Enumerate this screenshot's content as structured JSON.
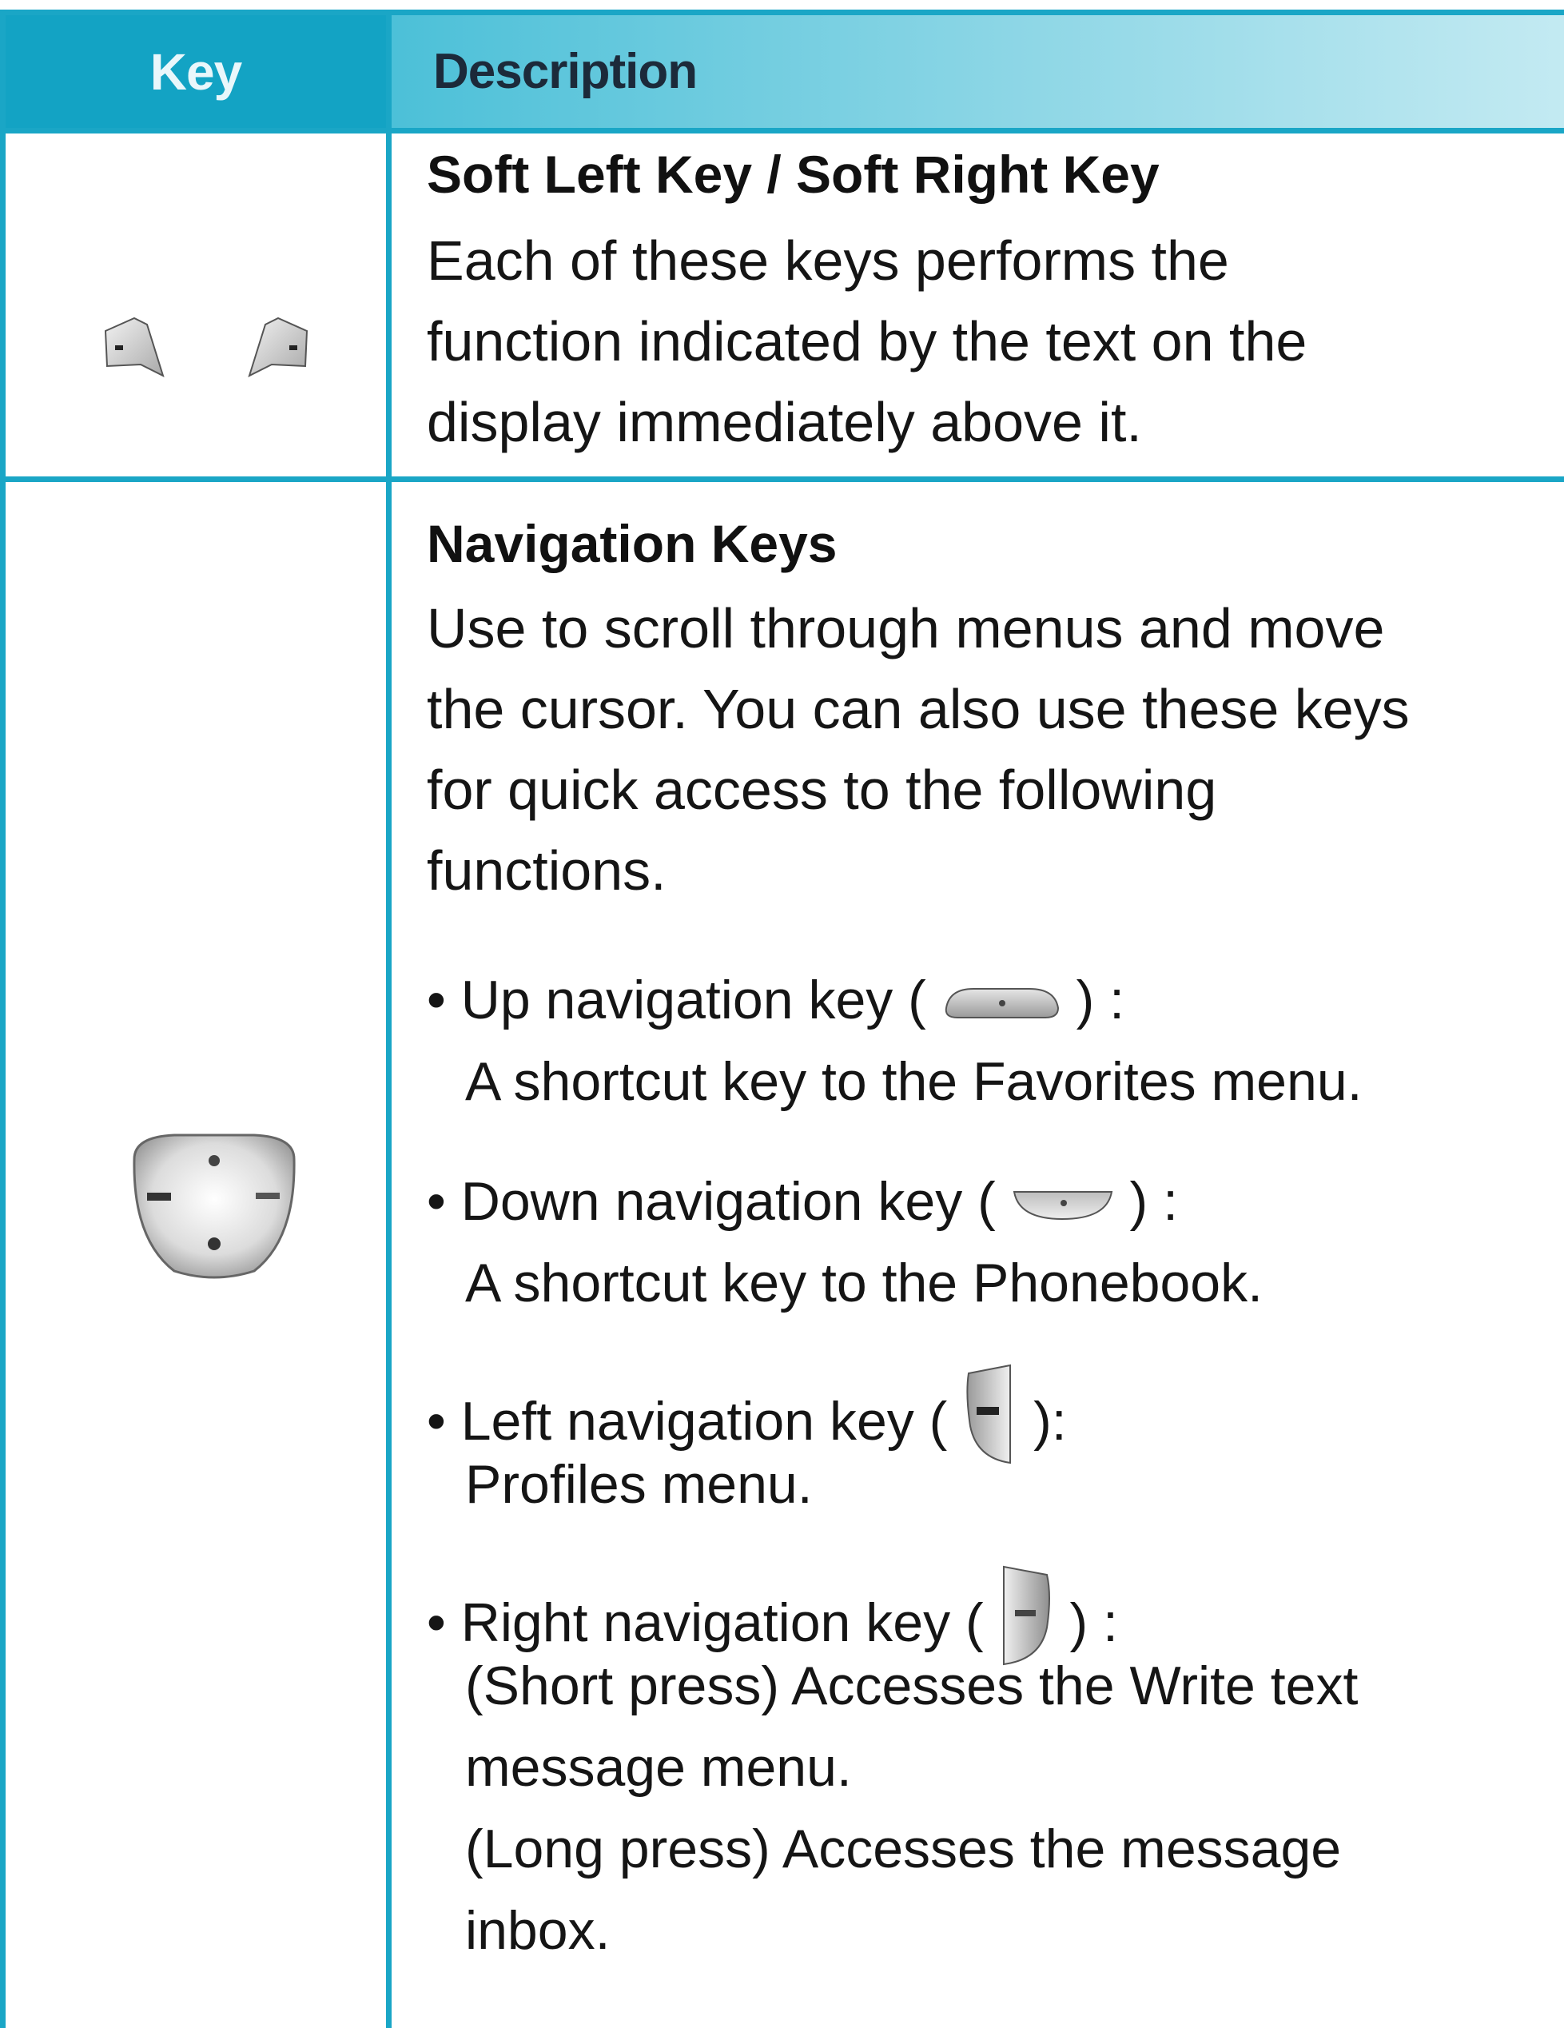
{
  "table": {
    "header": {
      "key": "Key",
      "description": "Description"
    },
    "rows": [
      {
        "key_icon": "soft-keys-icon",
        "title": "Soft Left Key / Soft Right Key",
        "description": [
          "Each of these keys performs the",
          "function indicated by the text on the",
          "display immediately above it."
        ]
      },
      {
        "key_icon": "navigation-keys-icon",
        "title": "Navigation Keys",
        "description": [
          "Use to scroll through menus and move",
          "the cursor. You can also use these keys",
          "for quick access to the following",
          "functions."
        ],
        "bullets": [
          {
            "icon": "up-navigation-key-icon",
            "label_before": "Up navigation key (",
            "label_after": ") :",
            "lines": [
              "A shortcut key to the Favorites menu."
            ]
          },
          {
            "icon": "down-navigation-key-icon",
            "label_before": "Down navigation key (",
            "label_after": ") :",
            "lines": [
              "A shortcut key to the Phonebook."
            ]
          },
          {
            "icon": "left-navigation-key-icon",
            "label_before": "Left navigation key (",
            "label_after": "):",
            "lines": [
              "Profiles menu."
            ]
          },
          {
            "icon": "right-navigation-key-icon",
            "label_before": "Right navigation key (",
            "label_after": ") :",
            "lines": [
              "(Short press) Accesses the Write text",
              "message menu.",
              "(Long press) Accesses the message",
              "inbox."
            ]
          }
        ]
      }
    ]
  },
  "colors": {
    "border": "#1aa6c6",
    "header_key_bg": "#13a3c4",
    "header_desc_bg_start": "#4cc0d8",
    "header_desc_bg_end": "#c3eaf2",
    "text": "#151515"
  }
}
